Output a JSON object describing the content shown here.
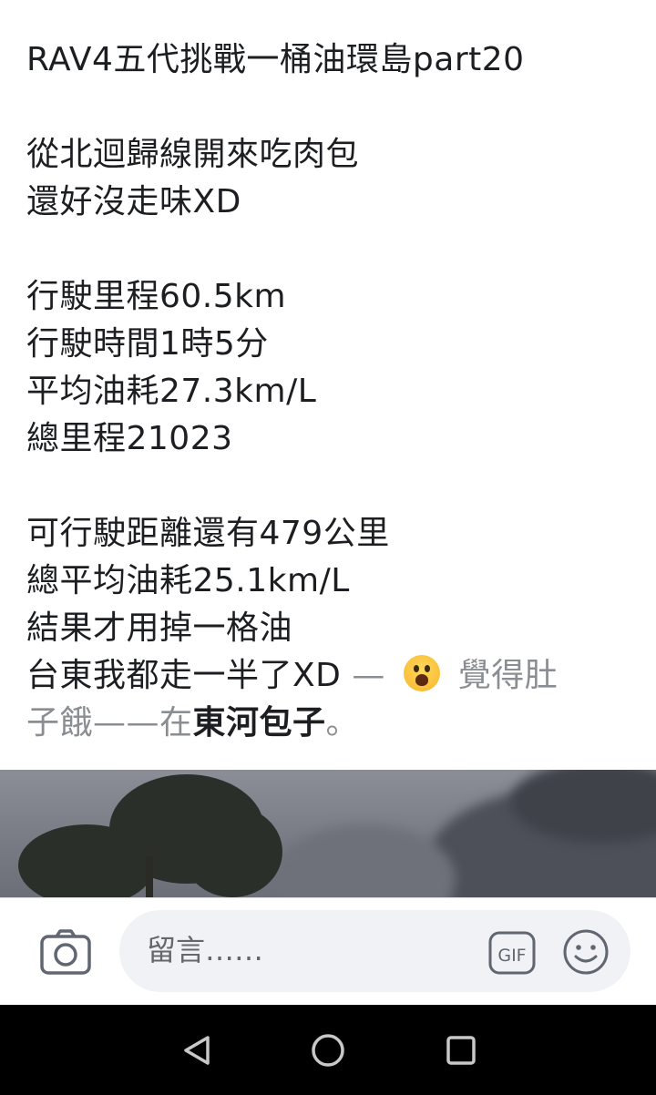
{
  "status_fragment": "·· ·· ··",
  "post": {
    "title": "RAV4五代挑戰一桶油環島part20",
    "intro": [
      "從北迴歸線開來吃肉包",
      "還好沒走味XD"
    ],
    "trip_stats": [
      "行駛里程60.5km",
      "行駛時間1時5分",
      "平均油耗27.3km/L",
      "總里程21023"
    ],
    "summary": [
      "可行駛距離還有479公里",
      "總平均油耗25.1km/L",
      "結果才用掉一格油"
    ],
    "last_line": "台東我都走一半了XD",
    "feeling_dash": "—",
    "feeling_text": "覺得肚",
    "feeling_text_2": "子餓——在",
    "place": "東河包子",
    "place_suffix": "。"
  },
  "comment_bar": {
    "placeholder": "留言……",
    "icons": [
      "camera-icon",
      "gif-icon",
      "smiley-icon"
    ]
  },
  "nav": {
    "icons": [
      "back-icon",
      "home-icon",
      "recents-icon"
    ]
  },
  "colors": {
    "text": "#1c1e21",
    "muted": "#8a8d91",
    "input_bg": "#f0f2f5",
    "nav_bg": "#000000"
  }
}
